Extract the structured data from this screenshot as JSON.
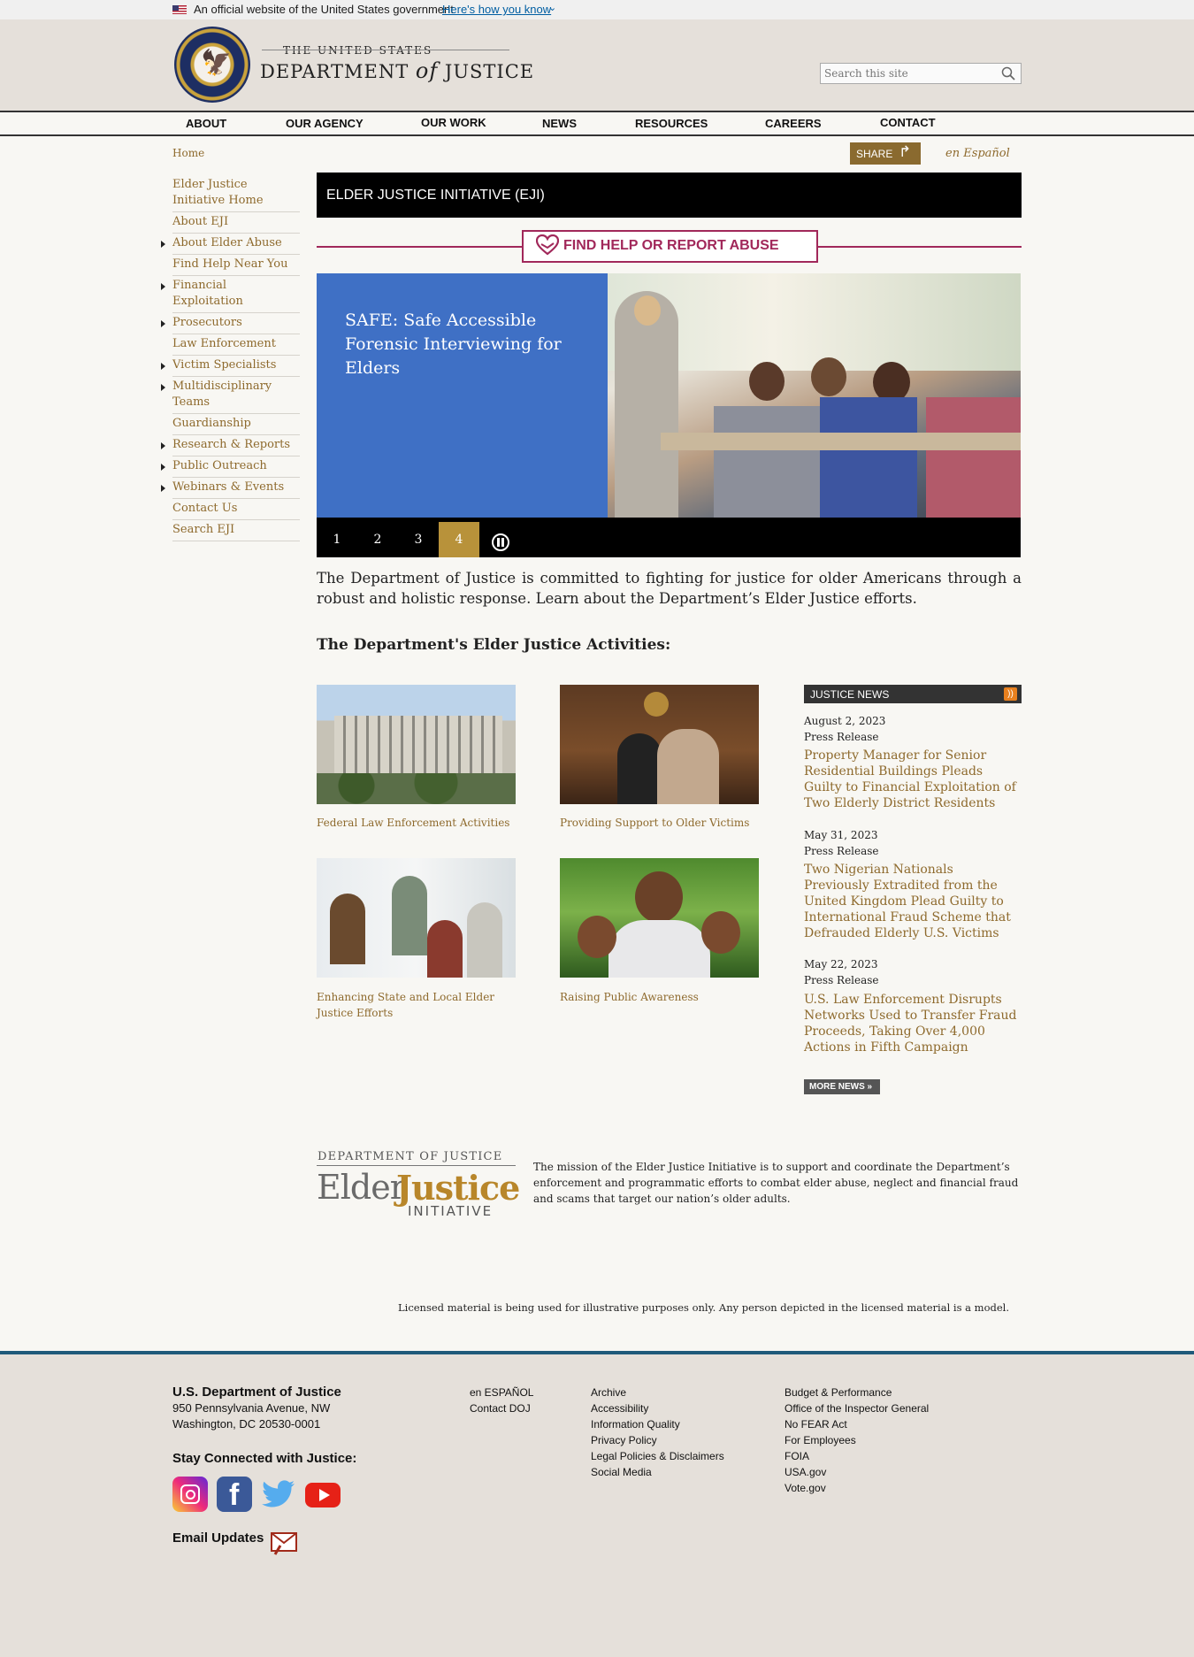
{
  "gov_banner": {
    "text": "An official website of the United States government",
    "link": "Here's how you know"
  },
  "header": {
    "line1": "THE UNITED STATES",
    "line2a": "DEPARTMENT",
    "line2b": "of",
    "line2c": "JUSTICE",
    "search_placeholder": "Search this site"
  },
  "nav": [
    "ABOUT",
    "OUR AGENCY",
    "OUR WORK",
    "NEWS",
    "RESOURCES",
    "CAREERS",
    "CONTACT"
  ],
  "breadcrumb": "Home",
  "share": "SHARE",
  "espanol": "en Español",
  "sidebar": [
    {
      "label": "Elder Justice Initiative Home",
      "arrow": false
    },
    {
      "label": "About EJI",
      "arrow": false
    },
    {
      "label": "About Elder Abuse",
      "arrow": true
    },
    {
      "label": "Find Help Near You",
      "arrow": false
    },
    {
      "label": "Financial Exploitation",
      "arrow": true
    },
    {
      "label": "Prosecutors",
      "arrow": true
    },
    {
      "label": "Law Enforcement",
      "arrow": false
    },
    {
      "label": "Victim Specialists",
      "arrow": true
    },
    {
      "label": "Multidisciplinary Teams",
      "arrow": true
    },
    {
      "label": "Guardianship",
      "arrow": false
    },
    {
      "label": "Research & Reports",
      "arrow": true
    },
    {
      "label": "Public Outreach",
      "arrow": true
    },
    {
      "label": "Webinars & Events",
      "arrow": true
    },
    {
      "label": "Contact Us",
      "arrow": false
    },
    {
      "label": "Search EJI",
      "arrow": false
    }
  ],
  "page_title": "ELDER JUSTICE INITIATIVE (EJI)",
  "help_button": "FIND HELP OR REPORT ABUSE",
  "slide": {
    "title": "SAFE: Safe Accessible Forensic Interviewing for Elders",
    "dots": [
      "1",
      "2",
      "3",
      "4"
    ],
    "active": "4"
  },
  "intro": "The Department of Justice is committed to fighting for justice for older Americans through a robust and holistic response. Learn about the Department’s Elder Justice efforts.",
  "activities_heading": "The Department's Elder Justice Activities:",
  "activities": [
    "Federal Law Enforcement Activities",
    "Providing Support to Older Victims",
    "Enhancing State and Local Elder Justice Efforts",
    "Raising Public Awareness"
  ],
  "news": {
    "heading": "JUSTICE NEWS",
    "items": [
      {
        "date": "August 2, 2023",
        "type": "Press Release",
        "title": "Property Manager for Senior Residential Buildings Pleads Guilty to Financial Exploitation of Two Elderly District Residents"
      },
      {
        "date": "May 31, 2023",
        "type": "Press Release",
        "title": "Two Nigerian Nationals Previously Extradited from the United Kingdom Plead Guilty to International Fraud Scheme that Defrauded Elderly U.S. Victims"
      },
      {
        "date": "May 22, 2023",
        "type": "Press Release",
        "title": "U.S. Law Enforcement Disrupts Networks Used to Transfer Fraud Proceeds, Taking Over 4,000 Actions in Fifth Campaign"
      }
    ],
    "more": "MORE NEWS »"
  },
  "eji_logo": {
    "top": "DEPARTMENT OF JUSTICE",
    "elder": "Elder",
    "justice": "Justice",
    "initiative": "INITIATIVE"
  },
  "mission": "The mission of the Elder Justice Initiative is to support and coordinate the Department’s enforcement and programmatic efforts to combat elder abuse, neglect and financial fraud and scams that target our nation’s older adults.",
  "license": "Licensed material is being used for illustrative purposes only. Any person depicted in the licensed material is a model.",
  "footer": {
    "org": "U.S. Department of Justice",
    "addr1": "950 Pennsylvania Avenue, NW",
    "addr2": "Washington, DC 20530-0001",
    "stay": "Stay Connected with Justice:",
    "email": "Email Updates",
    "col1": [
      "en ESPAÑOL",
      "Contact DOJ"
    ],
    "col2": [
      "Archive",
      "Accessibility",
      "Information Quality",
      "Privacy Policy",
      "Legal Policies & Disclaimers",
      "Social Media"
    ],
    "col3": [
      "Budget & Performance",
      "Office of the Inspector General",
      "No FEAR Act",
      "For Employees",
      "FOIA",
      "USA.gov",
      "Vote.gov"
    ]
  }
}
